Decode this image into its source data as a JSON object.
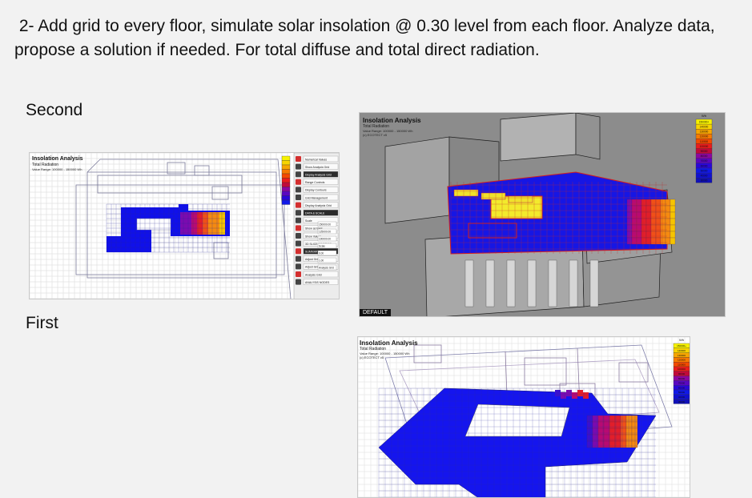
{
  "slide": {
    "title": " 2- Add grid to every floor, simulate solar insolation @ 0.30 level from each floor. Analyze data, propose a solution if needed. For total diffuse and total direct radiation.",
    "labels": {
      "second": "Second",
      "first": "First"
    }
  },
  "screenshots": {
    "second": {
      "title": "Insolation Analysis",
      "subtitle": "Total Radiation",
      "value_range": "Value Range: 100000 - 150000 Wh",
      "legend_colors": [
        "#f7f200",
        "#f7d400",
        "#f7a600",
        "#f77a00",
        "#f44a00",
        "#ea1c1c",
        "#c10a3a",
        "#8b06a0",
        "#5a06c0",
        "#2a06d8",
        "#1018e8"
      ],
      "panel_labels": [
        "Numerical Values",
        "Show Analysis Grid",
        "Display Analysis Grid",
        "Range Controls",
        "Display Contours",
        "Grid Management",
        "Display Analysis Grid",
        "DATA & SCALE",
        "Scale",
        "Show as Bars",
        "Show Values",
        "3D SLICE POSITION",
        "SUMMARY",
        "Adjust Grid Extents",
        "Adjust Grid Cells",
        "Analysis Grid",
        "ANALYSIS NODES"
      ],
      "panel_values": [
        "150000.00",
        "125000.00",
        "100000.00",
        "Scale",
        "0.00",
        "1.00",
        "Analysis Grid"
      ]
    },
    "top_right": {
      "title": "Insolation Analysis",
      "subtitle": "Total Radiation",
      "value_range": "Value Range: 100000 - 150000 Wh",
      "date_range": "(c) ECOTECT v5",
      "legend_unit": "Wh",
      "legend_values": [
        "150000+",
        "140000",
        "130000",
        "120000",
        "110000",
        "100000",
        "90000",
        "80000",
        "70000",
        "60000",
        "50000",
        "40000",
        "30000"
      ],
      "legend_colors": [
        "#f7f200",
        "#f7d400",
        "#f7a600",
        "#f77a00",
        "#f44a00",
        "#ea1c1c",
        "#c10a3a",
        "#8b06a0",
        "#5a06c0",
        "#2a06d8",
        "#1018e8",
        "#1010d0",
        "#1010b8"
      ],
      "status_tag": "DEFAULT"
    },
    "first": {
      "title": "Insolation Analysis",
      "subtitle": "Total Radiation",
      "value_range": "Value Range: 100000 - 150000 Wh",
      "date_range": "(c) ECOTECT v5",
      "legend_unit": "Wh",
      "legend_values": [
        "150000+",
        "140000",
        "130000",
        "120000",
        "110000",
        "100000",
        "90000",
        "80000",
        "70000",
        "60000",
        "50000",
        "40000",
        "30000"
      ],
      "legend_colors": [
        "#f7f200",
        "#f7d400",
        "#f7a600",
        "#f77a00",
        "#f44a00",
        "#ea1c1c",
        "#c10a3a",
        "#8b06a0",
        "#5a06c0",
        "#2a06d8",
        "#1018e8",
        "#1010d0",
        "#1010b8"
      ]
    }
  }
}
